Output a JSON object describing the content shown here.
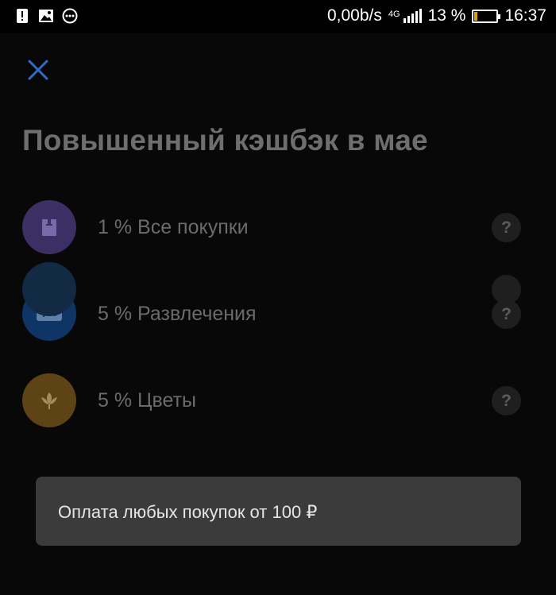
{
  "status_bar": {
    "net_speed": "0,00b/s",
    "net_type": "4G",
    "battery_percent": "13 %",
    "battery_level": 0.13,
    "time": "16:37",
    "left_icons": [
      "alert-icon",
      "image-icon",
      "more-dots-icon"
    ]
  },
  "header": {
    "close_icon": "close-icon",
    "title": "Повышенный кэшбэк в мае"
  },
  "cashback": {
    "items": [
      {
        "label": "1 % Все покупки",
        "icon": "shopping-bag-icon",
        "color": "#3b2f63",
        "help": "?"
      },
      {
        "label": "5 % Развлечения",
        "icon": "gamepad-icon",
        "color": "#0e3566",
        "help": "?"
      },
      {
        "label": "5 % Цветы",
        "icon": "flower-icon",
        "color": "#5e4317",
        "help": "?"
      }
    ]
  },
  "toast": {
    "text": "Оплата любых покупок от 100 ₽"
  },
  "colors": {
    "accent": "#2e6cc7",
    "background": "#080808",
    "toast_bg": "#3b3b3b"
  }
}
